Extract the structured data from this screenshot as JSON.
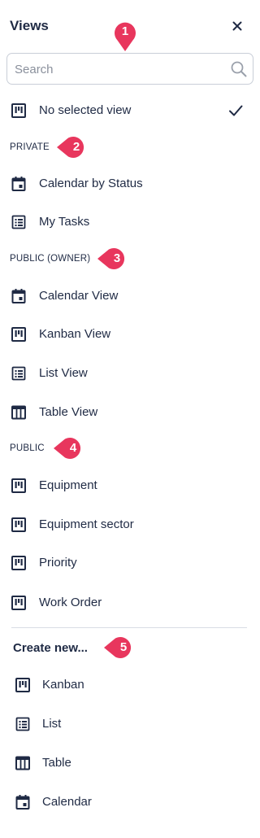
{
  "header": {
    "title": "Views"
  },
  "search": {
    "placeholder": "Search"
  },
  "no_selected": {
    "label": "No selected view"
  },
  "sections": {
    "private": "PRIVATE",
    "public_owner": "PUBLIC (OWNER)",
    "public": "PUBLIC"
  },
  "private_items": [
    {
      "label": "Calendar by Status",
      "icon": "calendar-icon"
    },
    {
      "label": "My Tasks",
      "icon": "list-icon"
    }
  ],
  "public_owner_items": [
    {
      "label": "Calendar View",
      "icon": "calendar-icon"
    },
    {
      "label": "Kanban View",
      "icon": "kanban-icon"
    },
    {
      "label": "List View",
      "icon": "list-icon"
    },
    {
      "label": "Table View",
      "icon": "table-icon"
    }
  ],
  "public_items": [
    {
      "label": "Equipment",
      "icon": "kanban-icon"
    },
    {
      "label": "Equipment sector",
      "icon": "kanban-icon"
    },
    {
      "label": "Priority",
      "icon": "kanban-icon"
    },
    {
      "label": "Work Order",
      "icon": "kanban-icon"
    }
  ],
  "create": {
    "title": "Create new...",
    "items": [
      {
        "label": "Kanban",
        "icon": "kanban-icon"
      },
      {
        "label": "List",
        "icon": "list-icon"
      },
      {
        "label": "Table",
        "icon": "table-icon"
      },
      {
        "label": "Calendar",
        "icon": "calendar-icon"
      }
    ]
  },
  "markers": [
    "1",
    "2",
    "3",
    "4",
    "5"
  ],
  "colors": {
    "text": "#1f2a44",
    "marker": "#e8365d",
    "border": "#c9ced8"
  }
}
